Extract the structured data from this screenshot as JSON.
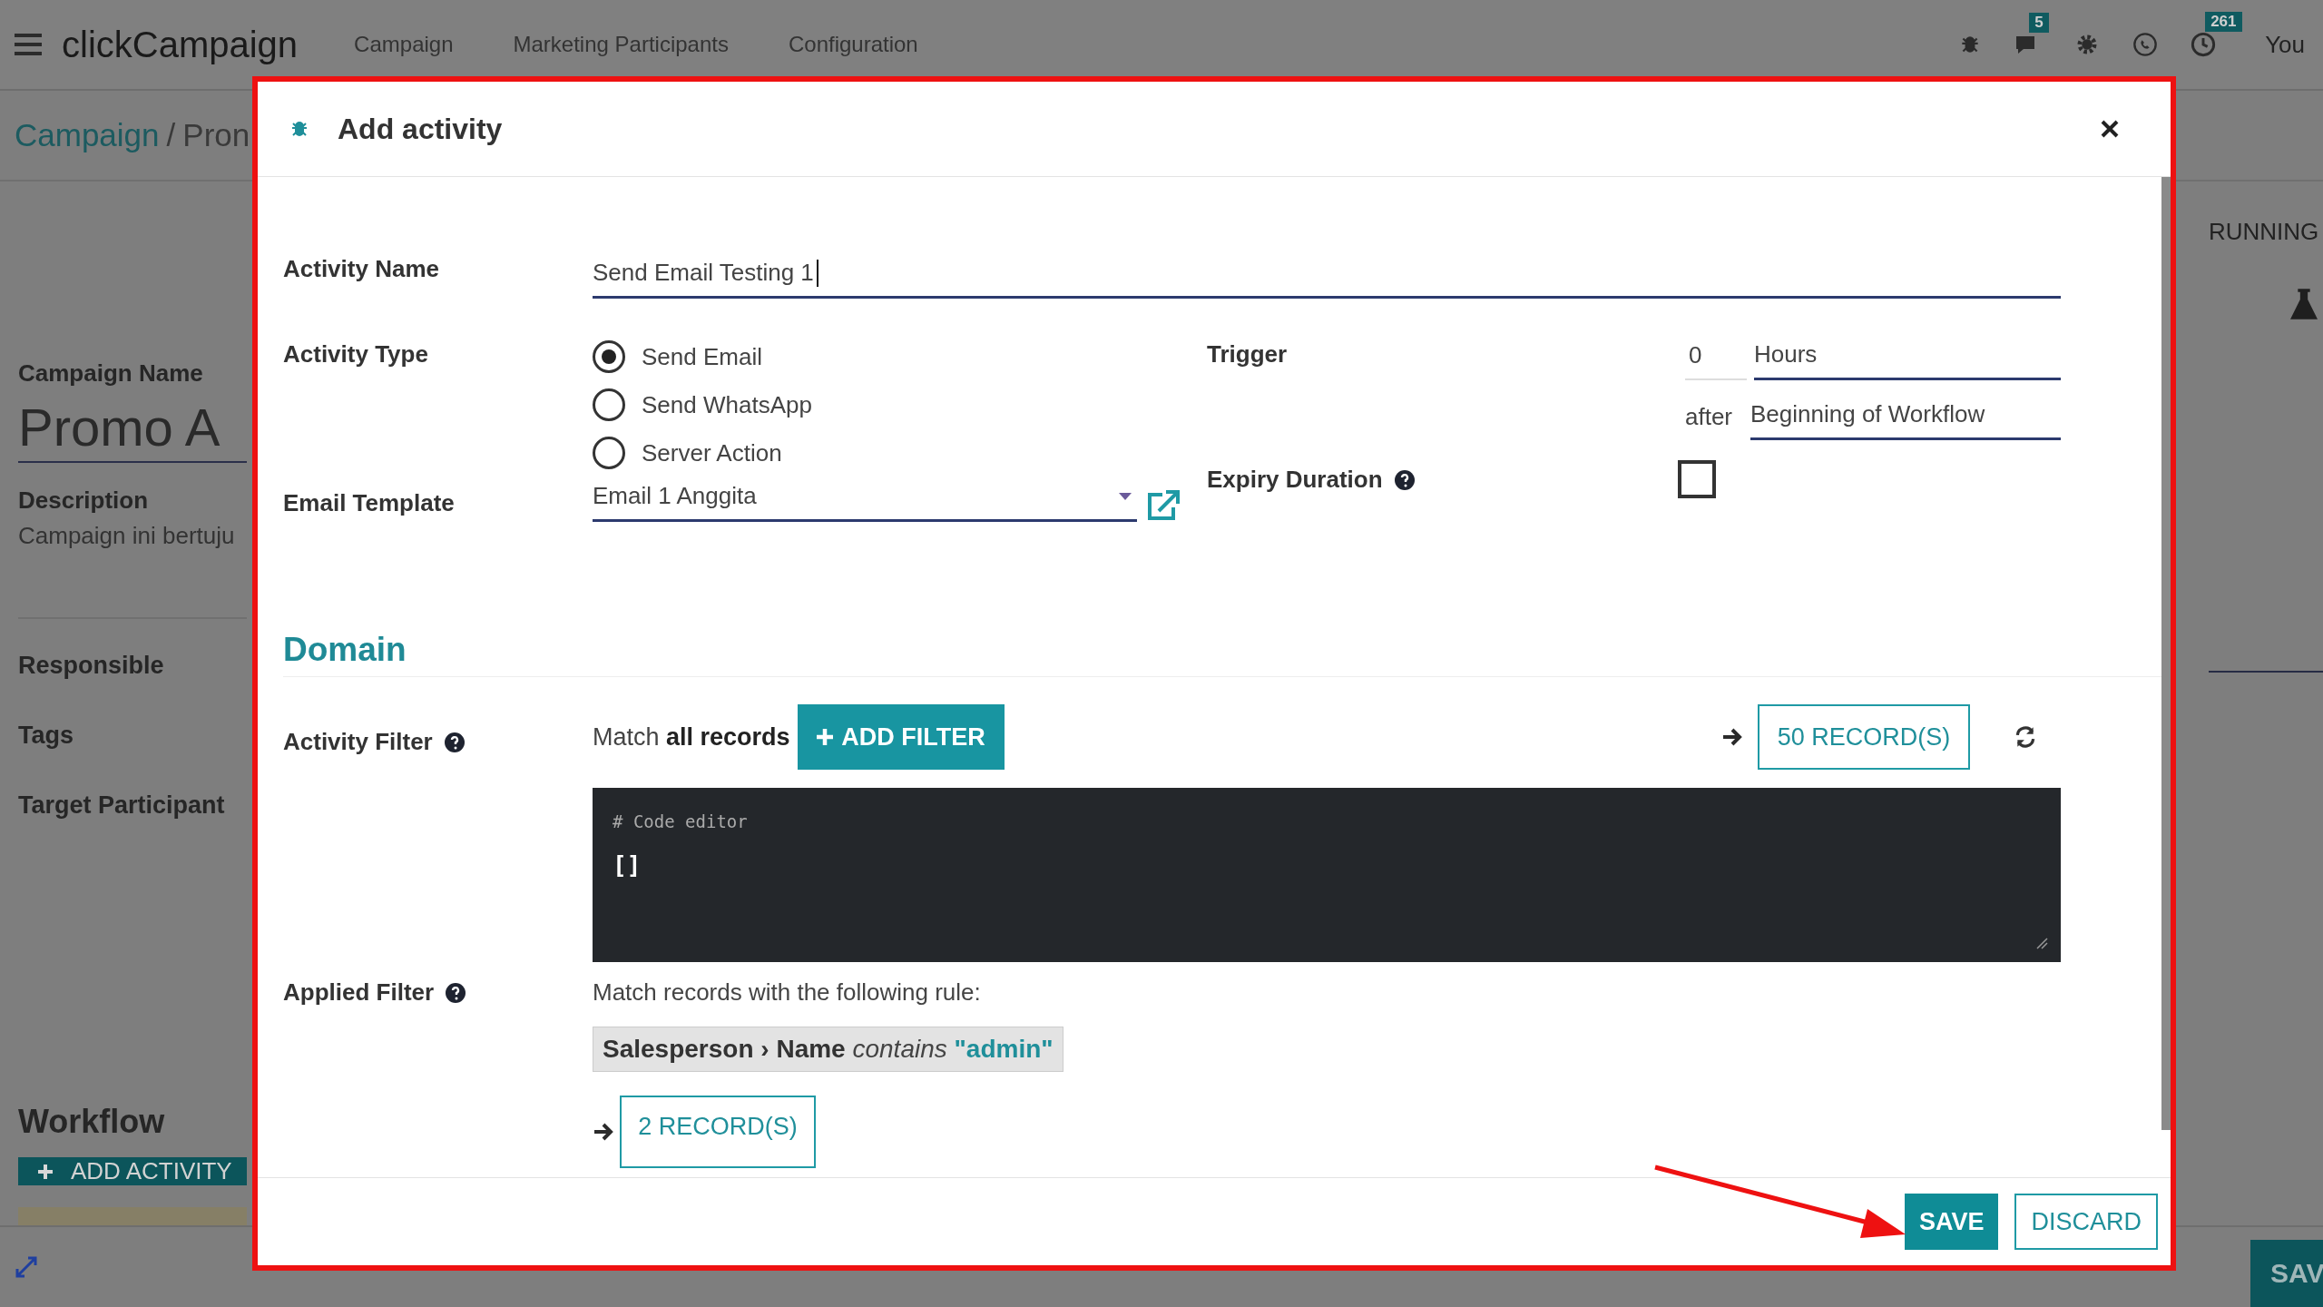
{
  "navbar": {
    "app_name": "clickCampaign",
    "menu": [
      "Campaign",
      "Marketing Participants",
      "Configuration"
    ],
    "messages_badge": "5",
    "activities_badge": "261",
    "user": "You"
  },
  "breadcrumb": {
    "parent": "Campaign",
    "separator": "/",
    "current": "Pron"
  },
  "status": "RUNNING",
  "form": {
    "campaign_name_label": "Campaign Name",
    "campaign_name": "Promo A",
    "description_label": "Description",
    "description": "Campaign ini bertuju",
    "fields": [
      "Responsible",
      "Tags",
      "Target Participant"
    ]
  },
  "workflow": {
    "title": "Workflow",
    "add_button": "ADD ACTIVITY"
  },
  "page_save_button": "SAV",
  "dialog": {
    "title": "Add activity",
    "activity_name": {
      "label": "Activity Name",
      "value": "Send Email Testing 1"
    },
    "activity_type": {
      "label": "Activity Type",
      "options": [
        {
          "label": "Send Email",
          "selected": true
        },
        {
          "label": "Send WhatsApp",
          "selected": false
        },
        {
          "label": "Server Action",
          "selected": false
        }
      ]
    },
    "email_template": {
      "label": "Email Template",
      "value": "Email 1 Anggita"
    },
    "trigger": {
      "label": "Trigger",
      "amount": "0",
      "unit": "Hours",
      "after_label": "after",
      "event": "Beginning of Workflow"
    },
    "expiry": {
      "label": "Expiry Duration",
      "checked": false
    },
    "domain": {
      "title": "Domain",
      "activity_filter_label": "Activity Filter",
      "match_text": "Match **all records**",
      "add_filter": "ADD FILTER",
      "records": "50 RECORD(S)",
      "code_comment": "# Code editor",
      "code": "[]",
      "applied_filter_label": "Applied Filter",
      "rule_intro": "Match records with the following rule:",
      "rule": {
        "path": "Salesperson › Name",
        "operator": "contains",
        "value": "\"admin\""
      },
      "applied_records": "2 RECORD(S)"
    },
    "buttons": [
      {
        "label": "SAVE",
        "kind": "primary"
      },
      {
        "label": "DISCARD",
        "kind": "secondary"
      }
    ]
  }
}
